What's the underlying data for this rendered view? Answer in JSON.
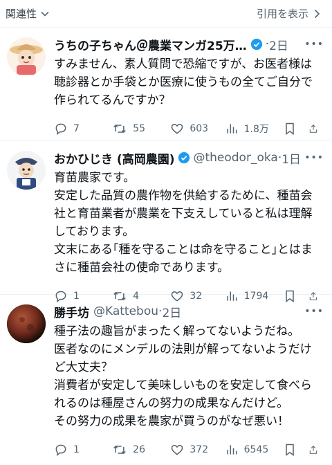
{
  "topbar": {
    "related_label": "関連性",
    "quote_label": "引用を表示"
  },
  "tweets": [
    {
      "name": "うちの子ちゃん＠農業マンガ25万…",
      "handle": "",
      "time": "2日",
      "text": "すみません、素人質問で恐縮ですが、お医者様は\n聴診器とか手袋とか医療に使うもの全てご自分で\n作られてるんですか？",
      "replies": "7",
      "reposts": "55",
      "likes": "603",
      "views": "1.8万",
      "verified": true
    },
    {
      "name": "おかひじき (高岡農園)",
      "handle": "@theodor_oka",
      "time": "1日",
      "text": "育苗農家です。\n安定した品質の農作物を供給するために、種苗会\n社と育苗業者が農業を下支えしていると私は理解\nしております。\n文末にある｢種を守ることは命を守ること｣とはま\nさに種苗会社の使命であります。",
      "replies": "1",
      "reposts": "4",
      "likes": "32",
      "views": "1794",
      "verified": true
    },
    {
      "name": "勝手坊",
      "handle": "@Kattebou",
      "time": "2日",
      "text": "種子法の趣旨がまったく解ってないようだね。\n医者なのにメンデルの法則が解ってないようだけ\nど大丈夫？\n消費者が安定して美味しいものを安定して食べら\nれるのは種屋さんの努力の成果なんだけど。\nその努力の成果を農家が買うのがなぜ悪い！",
      "replies": "1",
      "reposts": "26",
      "likes": "372",
      "views": "6545",
      "verified": false
    }
  ],
  "colors": {
    "text": "#0f1419",
    "muted": "#536471",
    "verified": "#1d9bf0",
    "divider": "#eff3f4"
  }
}
